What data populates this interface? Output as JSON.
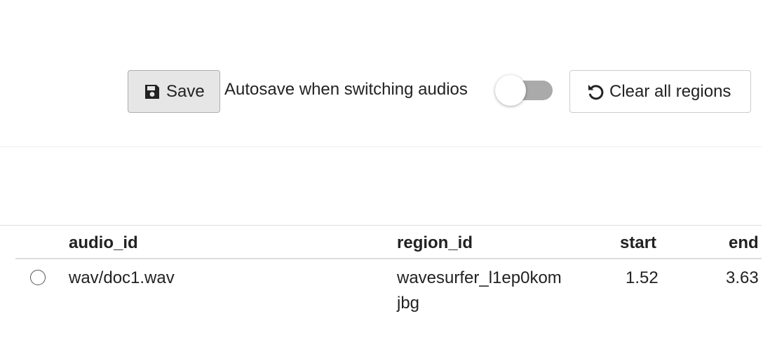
{
  "toolbar": {
    "save_label": "Save",
    "save_icon": "floppy-disk-icon",
    "autosave_label": "Autosave when switching audios",
    "autosave_enabled": false,
    "clear_label": "Clear all regions",
    "clear_icon": "undo-arrow-icon"
  },
  "table": {
    "columns": [
      "audio_id",
      "region_id",
      "start",
      "end"
    ],
    "rows": [
      {
        "selected": false,
        "audio_id": "wav/doc1.wav",
        "region_id": "wavesurfer_l1ep0komjbg",
        "start": "1.52",
        "end": "3.63"
      }
    ]
  }
}
